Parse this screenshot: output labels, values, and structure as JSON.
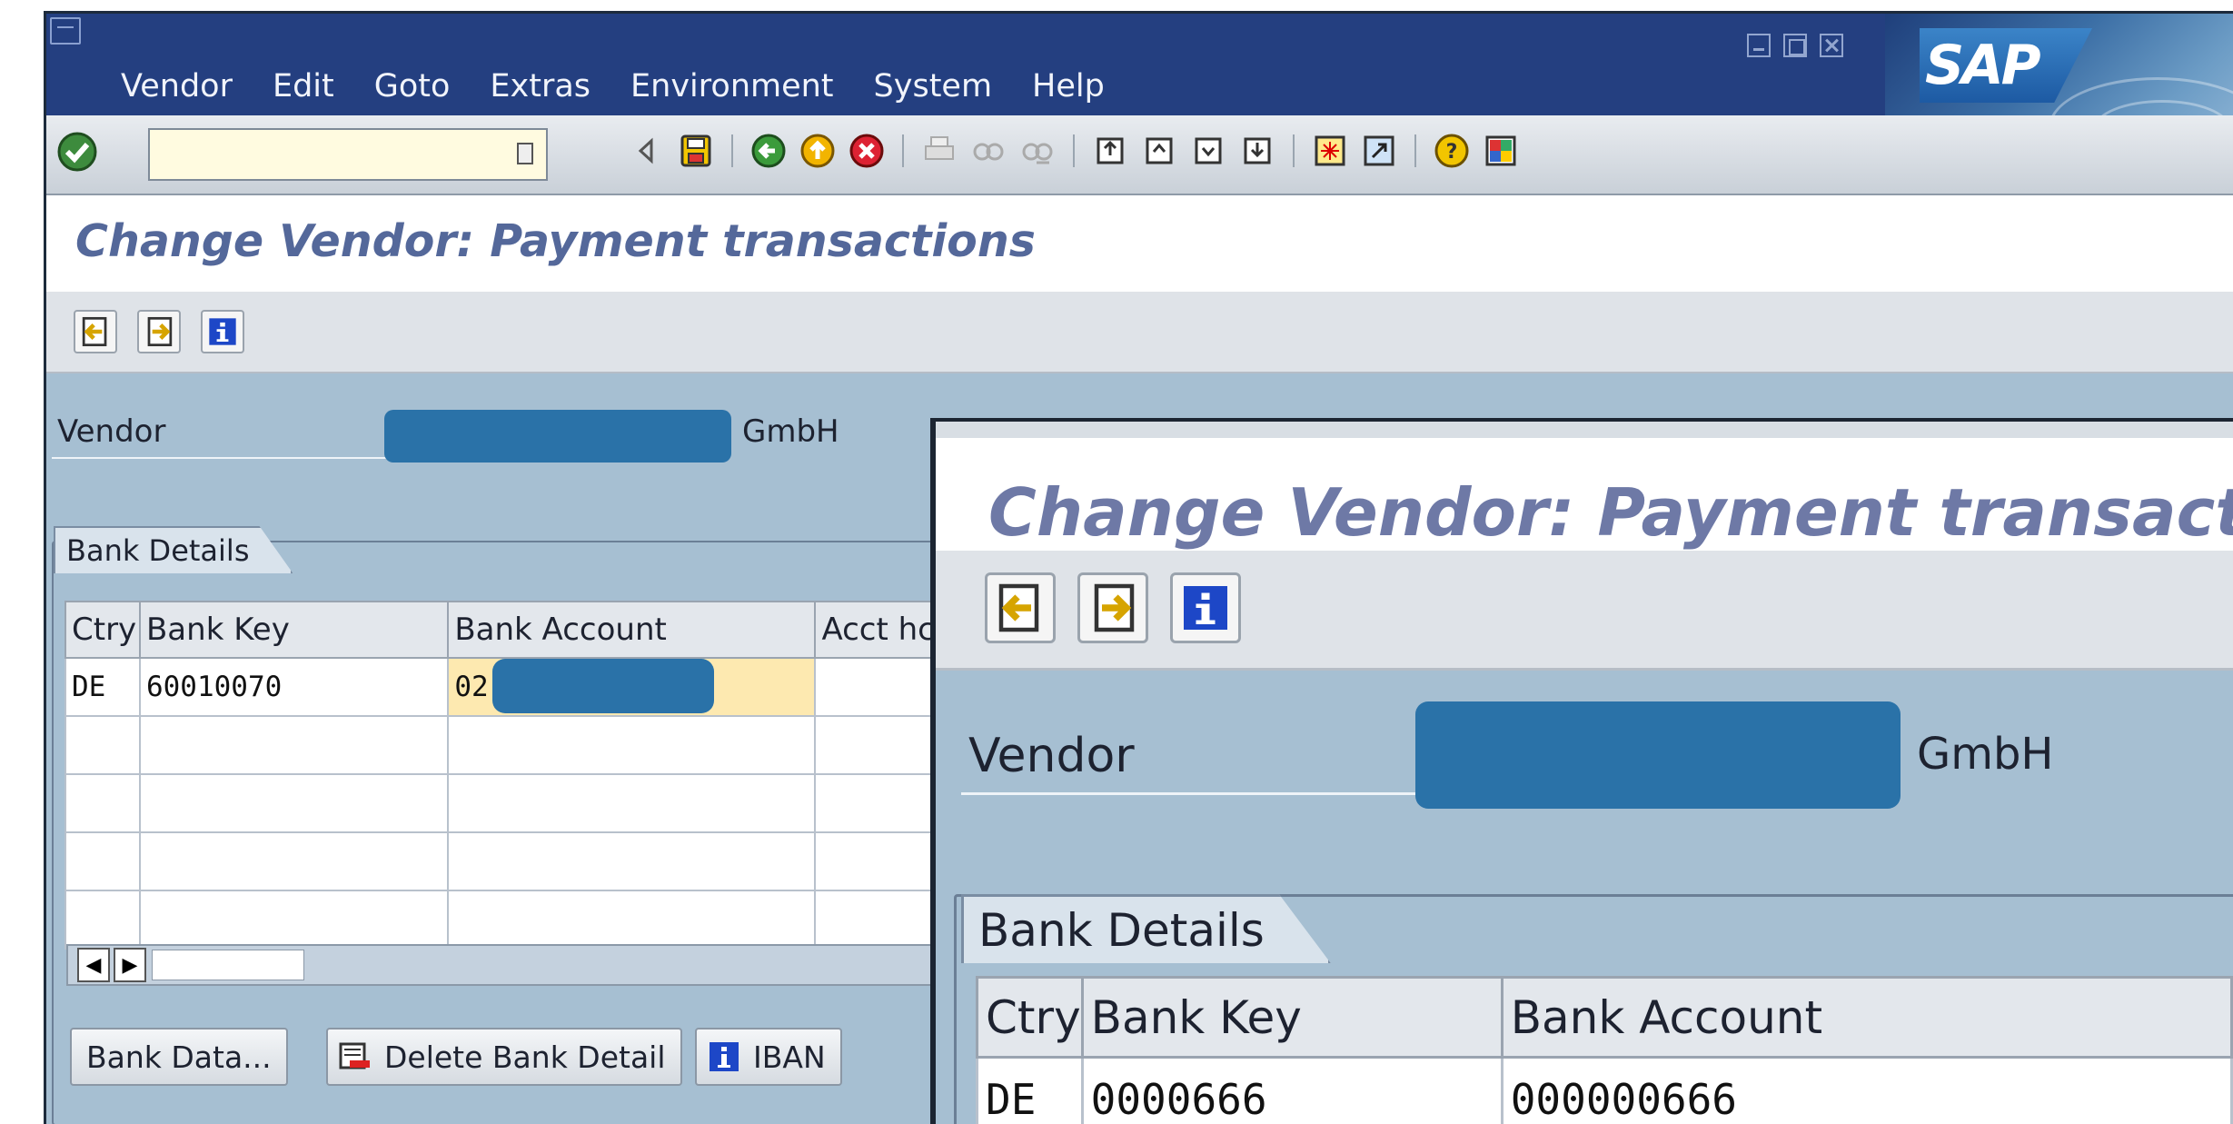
{
  "menu": [
    "Vendor",
    "Edit",
    "Goto",
    "Extras",
    "Environment",
    "System",
    "Help"
  ],
  "brand": {
    "logo_text": "SAP"
  },
  "command_field": {
    "value": ""
  },
  "page": {
    "title": "Change Vendor: Payment transactions"
  },
  "vendor": {
    "label": "Vendor",
    "name_suffix": "GmbH"
  },
  "bank_details": {
    "group_label": "Bank Details",
    "columns": [
      "Ctry",
      "Bank Key",
      "Bank Account",
      "Acct hc"
    ],
    "rows": [
      {
        "ctry": "DE",
        "bank_key": "60010070",
        "bank_account": "02"
      }
    ]
  },
  "buttons": {
    "bank_data": "Bank Data...",
    "delete_bank_detail": "Delete Bank Detail",
    "iban": "IBAN"
  },
  "zoom": {
    "title": "Change Vendor: Payment transactions",
    "vendor_label": "Vendor",
    "vendor_suffix": "GmbH",
    "group_label": "Bank Details",
    "columns": [
      "Ctry",
      "Bank Key",
      "Bank Account"
    ],
    "row": {
      "ctry": "DE",
      "bank_key": "0000666",
      "bank_account": "000000666"
    }
  },
  "colors": {
    "titlebar": "#243f80",
    "background": "#a6bfd2",
    "title_text": "#54689a",
    "highlight_cell": "#fde9b0",
    "redaction": "#2a72a8"
  }
}
